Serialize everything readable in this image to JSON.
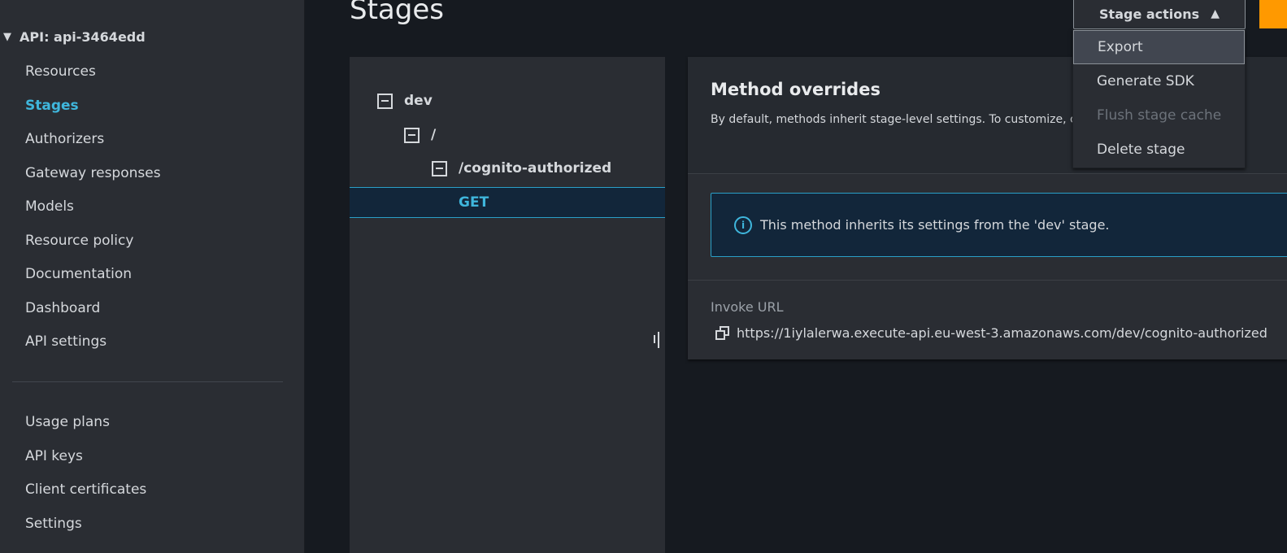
{
  "sidebar": {
    "api_title": "API: api-3464edd",
    "items": [
      {
        "label": "Resources"
      },
      {
        "label": "Stages",
        "active": true
      },
      {
        "label": "Authorizers"
      },
      {
        "label": "Gateway responses"
      },
      {
        "label": "Models"
      },
      {
        "label": "Resource policy"
      },
      {
        "label": "Documentation"
      },
      {
        "label": "Dashboard"
      },
      {
        "label": "API settings"
      }
    ],
    "items2": [
      {
        "label": "Usage plans"
      },
      {
        "label": "API keys"
      },
      {
        "label": "Client certificates"
      },
      {
        "label": "Settings"
      }
    ]
  },
  "page": {
    "title": "Stages"
  },
  "stage_actions": {
    "label": "Stage actions",
    "menu": [
      {
        "label": "Export",
        "highlighted": true
      },
      {
        "label": "Generate SDK"
      },
      {
        "label": "Flush stage cache",
        "disabled": true
      },
      {
        "label": "Delete stage"
      }
    ]
  },
  "tree": {
    "stage": "dev",
    "root": "/",
    "resource": "/cognito-authorized",
    "method": "GET"
  },
  "panel": {
    "title": "Method overrides",
    "description": "By default, methods inherit stage-level settings. To customize, configure method overrides.",
    "alert": "This method inherits its settings from the 'dev' stage.",
    "invoke_url_label": "Invoke URL",
    "invoke_url": "https://1iylalerwa.execute-api.eu-west-3.amazonaws.com/dev/cognito-authorized"
  },
  "colors": {
    "accent": "#3fb6dc",
    "primary": "#ff9900"
  }
}
